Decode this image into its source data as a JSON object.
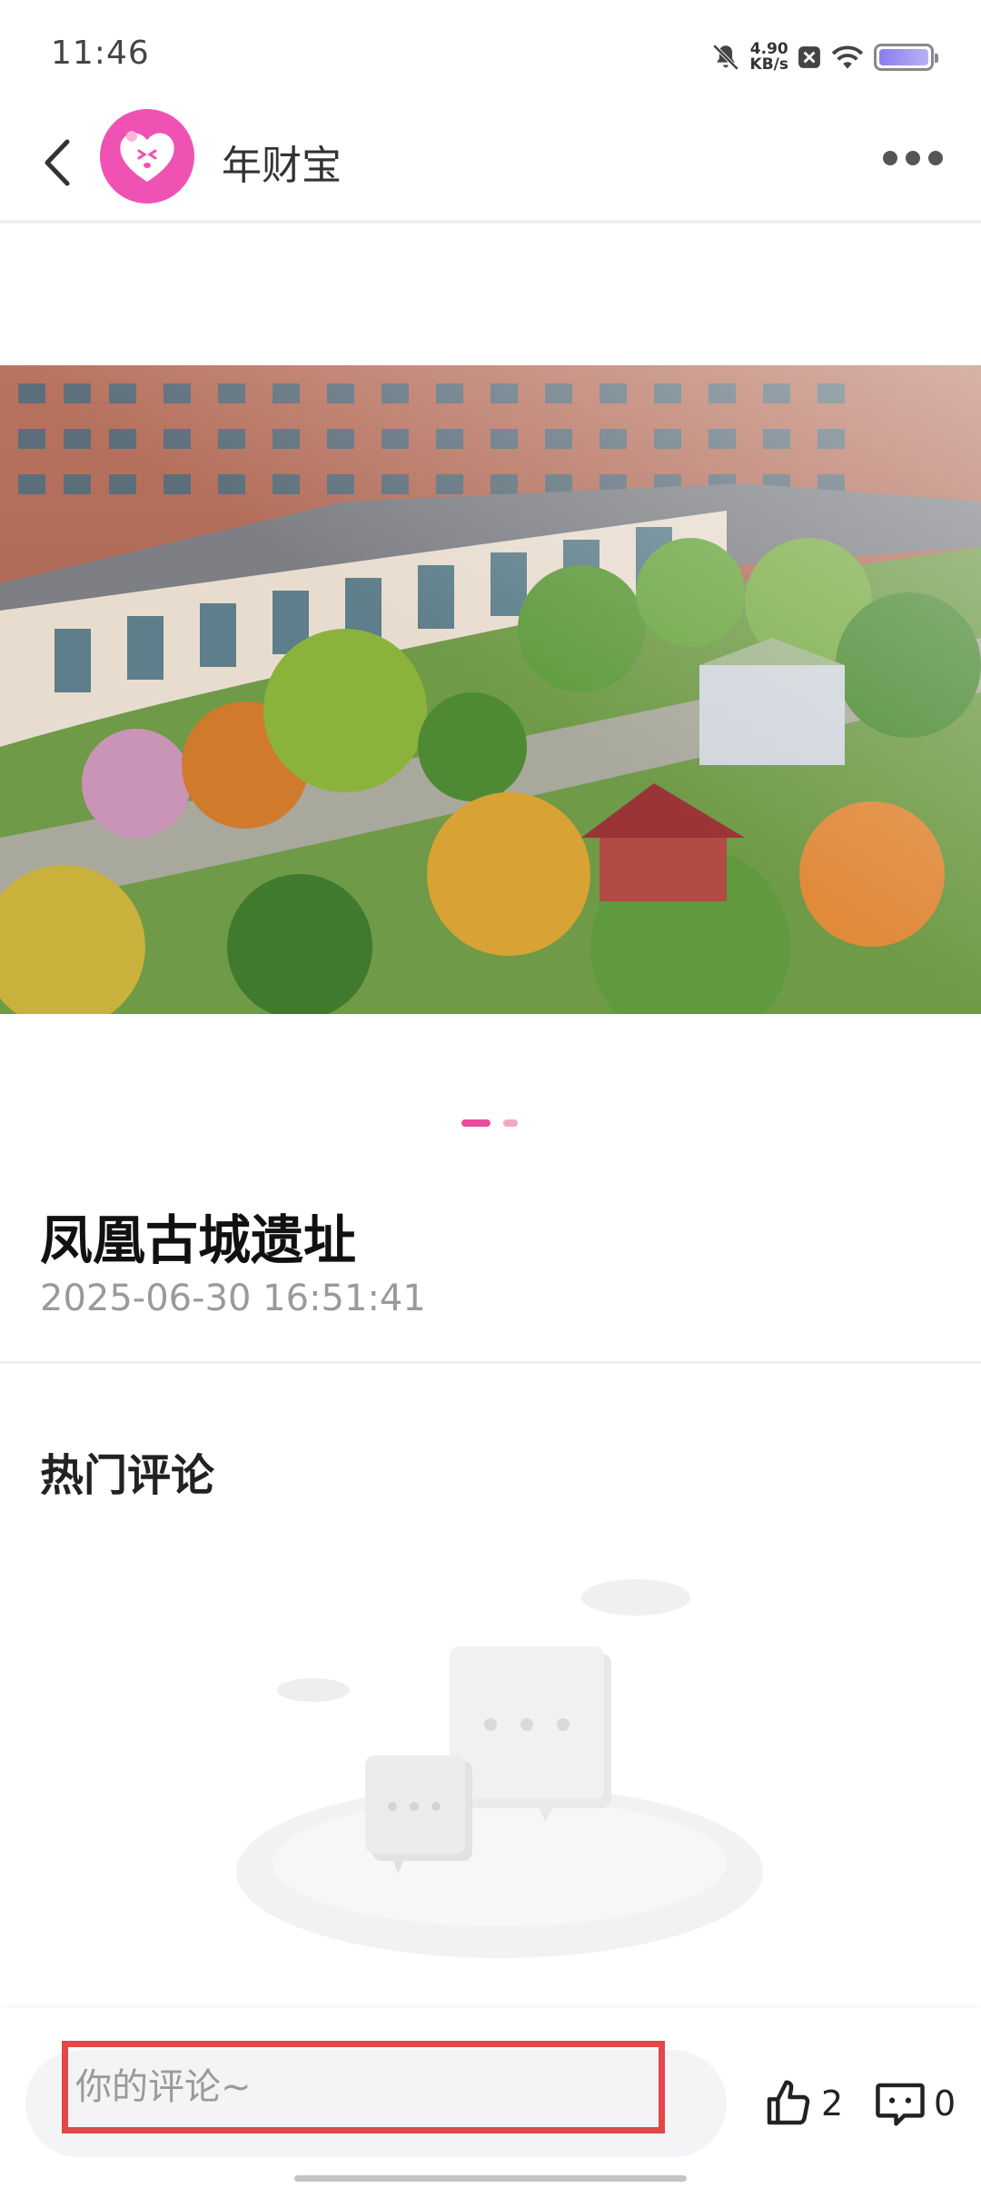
{
  "status_bar": {
    "time": "11:46",
    "net_speed_value": "4.90",
    "net_speed_unit": "KB/s",
    "icons": [
      "mute-bell-icon",
      "app-notification-icon",
      "wifi-icon",
      "battery-icon"
    ]
  },
  "header": {
    "back_icon": "chevron-left-icon",
    "title": "年财宝",
    "more_icon": "more-dots-icon",
    "avatar_color": "#f052b4"
  },
  "carousel": {
    "image": "building-garden-photo",
    "page_count": 2,
    "active_index": 0,
    "active_color": "#ec4a9d",
    "inactive_color": "#f4a7cb"
  },
  "post": {
    "title": "凤凰古城遗址",
    "datetime": "2025-06-30 16:51:41"
  },
  "comments": {
    "section_title": "热门评论",
    "empty_illustration": "empty-comments-icon"
  },
  "bottom_bar": {
    "comment_placeholder": "你的评论~",
    "like_icon": "thumbs-up-icon",
    "like_count": "2",
    "comment_icon": "comment-bubble-icon",
    "comment_count": "0",
    "highlight_color": "#e24848"
  }
}
